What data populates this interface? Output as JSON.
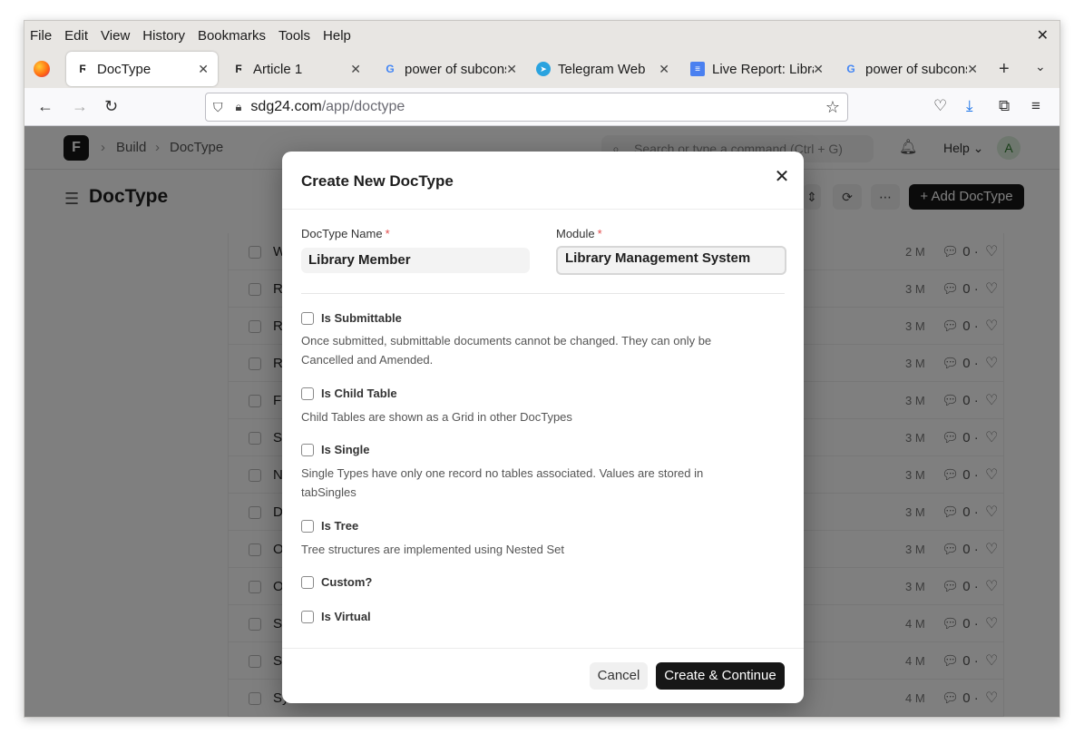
{
  "menubar": {
    "items": [
      "File",
      "Edit",
      "View",
      "History",
      "Bookmarks",
      "Tools",
      "Help"
    ]
  },
  "tabs": [
    {
      "title": "DocType",
      "icon": "frappe-icon"
    },
    {
      "title": "Article 1",
      "icon": "frappe-icon"
    },
    {
      "title": "power of subconscious",
      "icon": "google-icon"
    },
    {
      "title": "Telegram Web",
      "icon": "telegram-icon"
    },
    {
      "title": "Live Report: Library",
      "icon": "docs-icon"
    },
    {
      "title": "power of subconscious",
      "icon": "google-icon"
    }
  ],
  "urlbar": {
    "host": "sdg24.com",
    "path": "/app/doctype"
  },
  "app": {
    "logo": "F",
    "breadcrumbs": [
      "Build",
      "DocType"
    ],
    "search_placeholder": "Search or type a command (Ctrl + G)",
    "help_label": "Help",
    "avatar": "A",
    "page_title": "DocType",
    "add_button": "+ Add DocType"
  },
  "list_rows": [
    {
      "letter": "W",
      "age": "2 M",
      "comments": "0"
    },
    {
      "letter": "R",
      "age": "3 M",
      "comments": "0"
    },
    {
      "letter": "R",
      "age": "3 M",
      "comments": "0"
    },
    {
      "letter": "R",
      "age": "3 M",
      "comments": "0"
    },
    {
      "letter": "F",
      "age": "3 M",
      "comments": "0"
    },
    {
      "letter": "S",
      "age": "3 M",
      "comments": "0"
    },
    {
      "letter": "N",
      "age": "3 M",
      "comments": "0"
    },
    {
      "letter": "D",
      "age": "3 M",
      "comments": "0"
    },
    {
      "letter": "O",
      "age": "3 M",
      "comments": "0"
    },
    {
      "letter": "O",
      "age": "3 M",
      "comments": "0"
    },
    {
      "letter": "S",
      "age": "4 M",
      "comments": "0"
    },
    {
      "letter": "S",
      "age": "4 M",
      "comments": "0"
    },
    {
      "letter": "Sy",
      "age": "4 M",
      "comments": "0"
    }
  ],
  "modal": {
    "title": "Create New DocType",
    "doctype_name_label": "DocType Name",
    "doctype_name_value": "Library Member",
    "module_label": "Module",
    "module_value": "Library Management System",
    "required_mark": "*",
    "options": {
      "is_submittable": {
        "label": "Is Submittable",
        "desc": "Once submitted, submittable documents cannot be changed. They can only be Cancelled and Amended."
      },
      "is_child_table": {
        "label": "Is Child Table",
        "desc": "Child Tables are shown as a Grid in other DocTypes"
      },
      "is_single": {
        "label": "Is Single",
        "desc": "Single Types have only one record no tables associated. Values are stored in tabSingles"
      },
      "is_tree": {
        "label": "Is Tree",
        "desc": "Tree structures are implemented using Nested Set"
      },
      "custom": {
        "label": "Custom?"
      },
      "is_virtual": {
        "label": "Is Virtual"
      }
    },
    "cancel_label": "Cancel",
    "create_label": "Create & Continue"
  }
}
